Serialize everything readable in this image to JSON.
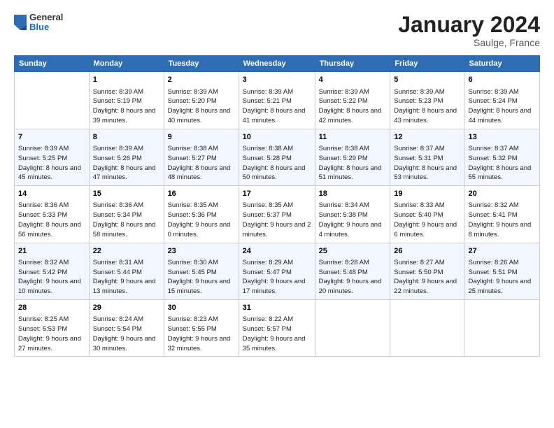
{
  "header": {
    "logo_general": "General",
    "logo_blue": "Blue",
    "month_title": "January 2024",
    "location": "Saulge, France"
  },
  "days_of_week": [
    "Sunday",
    "Monday",
    "Tuesday",
    "Wednesday",
    "Thursday",
    "Friday",
    "Saturday"
  ],
  "weeks": [
    [
      {
        "day": "",
        "sunrise": "",
        "sunset": "",
        "daylight": ""
      },
      {
        "day": "1",
        "sunrise": "Sunrise: 8:39 AM",
        "sunset": "Sunset: 5:19 PM",
        "daylight": "Daylight: 8 hours and 39 minutes."
      },
      {
        "day": "2",
        "sunrise": "Sunrise: 8:39 AM",
        "sunset": "Sunset: 5:20 PM",
        "daylight": "Daylight: 8 hours and 40 minutes."
      },
      {
        "day": "3",
        "sunrise": "Sunrise: 8:39 AM",
        "sunset": "Sunset: 5:21 PM",
        "daylight": "Daylight: 8 hours and 41 minutes."
      },
      {
        "day": "4",
        "sunrise": "Sunrise: 8:39 AM",
        "sunset": "Sunset: 5:22 PM",
        "daylight": "Daylight: 8 hours and 42 minutes."
      },
      {
        "day": "5",
        "sunrise": "Sunrise: 8:39 AM",
        "sunset": "Sunset: 5:23 PM",
        "daylight": "Daylight: 8 hours and 43 minutes."
      },
      {
        "day": "6",
        "sunrise": "Sunrise: 8:39 AM",
        "sunset": "Sunset: 5:24 PM",
        "daylight": "Daylight: 8 hours and 44 minutes."
      }
    ],
    [
      {
        "day": "7",
        "sunrise": "Sunrise: 8:39 AM",
        "sunset": "Sunset: 5:25 PM",
        "daylight": "Daylight: 8 hours and 45 minutes."
      },
      {
        "day": "8",
        "sunrise": "Sunrise: 8:39 AM",
        "sunset": "Sunset: 5:26 PM",
        "daylight": "Daylight: 8 hours and 47 minutes."
      },
      {
        "day": "9",
        "sunrise": "Sunrise: 8:38 AM",
        "sunset": "Sunset: 5:27 PM",
        "daylight": "Daylight: 8 hours and 48 minutes."
      },
      {
        "day": "10",
        "sunrise": "Sunrise: 8:38 AM",
        "sunset": "Sunset: 5:28 PM",
        "daylight": "Daylight: 8 hours and 50 minutes."
      },
      {
        "day": "11",
        "sunrise": "Sunrise: 8:38 AM",
        "sunset": "Sunset: 5:29 PM",
        "daylight": "Daylight: 8 hours and 51 minutes."
      },
      {
        "day": "12",
        "sunrise": "Sunrise: 8:37 AM",
        "sunset": "Sunset: 5:31 PM",
        "daylight": "Daylight: 8 hours and 53 minutes."
      },
      {
        "day": "13",
        "sunrise": "Sunrise: 8:37 AM",
        "sunset": "Sunset: 5:32 PM",
        "daylight": "Daylight: 8 hours and 55 minutes."
      }
    ],
    [
      {
        "day": "14",
        "sunrise": "Sunrise: 8:36 AM",
        "sunset": "Sunset: 5:33 PM",
        "daylight": "Daylight: 8 hours and 56 minutes."
      },
      {
        "day": "15",
        "sunrise": "Sunrise: 8:36 AM",
        "sunset": "Sunset: 5:34 PM",
        "daylight": "Daylight: 8 hours and 58 minutes."
      },
      {
        "day": "16",
        "sunrise": "Sunrise: 8:35 AM",
        "sunset": "Sunset: 5:36 PM",
        "daylight": "Daylight: 9 hours and 0 minutes."
      },
      {
        "day": "17",
        "sunrise": "Sunrise: 8:35 AM",
        "sunset": "Sunset: 5:37 PM",
        "daylight": "Daylight: 9 hours and 2 minutes."
      },
      {
        "day": "18",
        "sunrise": "Sunrise: 8:34 AM",
        "sunset": "Sunset: 5:38 PM",
        "daylight": "Daylight: 9 hours and 4 minutes."
      },
      {
        "day": "19",
        "sunrise": "Sunrise: 8:33 AM",
        "sunset": "Sunset: 5:40 PM",
        "daylight": "Daylight: 9 hours and 6 minutes."
      },
      {
        "day": "20",
        "sunrise": "Sunrise: 8:32 AM",
        "sunset": "Sunset: 5:41 PM",
        "daylight": "Daylight: 9 hours and 8 minutes."
      }
    ],
    [
      {
        "day": "21",
        "sunrise": "Sunrise: 8:32 AM",
        "sunset": "Sunset: 5:42 PM",
        "daylight": "Daylight: 9 hours and 10 minutes."
      },
      {
        "day": "22",
        "sunrise": "Sunrise: 8:31 AM",
        "sunset": "Sunset: 5:44 PM",
        "daylight": "Daylight: 9 hours and 13 minutes."
      },
      {
        "day": "23",
        "sunrise": "Sunrise: 8:30 AM",
        "sunset": "Sunset: 5:45 PM",
        "daylight": "Daylight: 9 hours and 15 minutes."
      },
      {
        "day": "24",
        "sunrise": "Sunrise: 8:29 AM",
        "sunset": "Sunset: 5:47 PM",
        "daylight": "Daylight: 9 hours and 17 minutes."
      },
      {
        "day": "25",
        "sunrise": "Sunrise: 8:28 AM",
        "sunset": "Sunset: 5:48 PM",
        "daylight": "Daylight: 9 hours and 20 minutes."
      },
      {
        "day": "26",
        "sunrise": "Sunrise: 8:27 AM",
        "sunset": "Sunset: 5:50 PM",
        "daylight": "Daylight: 9 hours and 22 minutes."
      },
      {
        "day": "27",
        "sunrise": "Sunrise: 8:26 AM",
        "sunset": "Sunset: 5:51 PM",
        "daylight": "Daylight: 9 hours and 25 minutes."
      }
    ],
    [
      {
        "day": "28",
        "sunrise": "Sunrise: 8:25 AM",
        "sunset": "Sunset: 5:53 PM",
        "daylight": "Daylight: 9 hours and 27 minutes."
      },
      {
        "day": "29",
        "sunrise": "Sunrise: 8:24 AM",
        "sunset": "Sunset: 5:54 PM",
        "daylight": "Daylight: 9 hours and 30 minutes."
      },
      {
        "day": "30",
        "sunrise": "Sunrise: 8:23 AM",
        "sunset": "Sunset: 5:55 PM",
        "daylight": "Daylight: 9 hours and 32 minutes."
      },
      {
        "day": "31",
        "sunrise": "Sunrise: 8:22 AM",
        "sunset": "Sunset: 5:57 PM",
        "daylight": "Daylight: 9 hours and 35 minutes."
      },
      {
        "day": "",
        "sunrise": "",
        "sunset": "",
        "daylight": ""
      },
      {
        "day": "",
        "sunrise": "",
        "sunset": "",
        "daylight": ""
      },
      {
        "day": "",
        "sunrise": "",
        "sunset": "",
        "daylight": ""
      }
    ]
  ]
}
